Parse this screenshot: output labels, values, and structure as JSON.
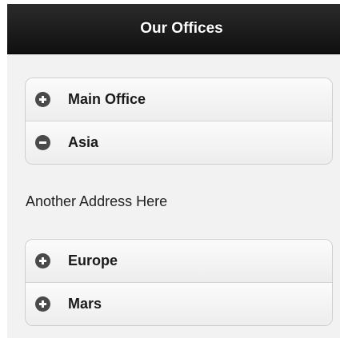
{
  "header": {
    "title": "Our Offices"
  },
  "offices": {
    "main_office": {
      "label": "Main Office",
      "icon": "plus-circle-icon"
    },
    "asia": {
      "label": "Asia",
      "icon": "minus-circle-icon",
      "content": "Another Address Here"
    },
    "europe": {
      "label": "Europe",
      "icon": "plus-circle-icon"
    },
    "mars": {
      "label": "Mars",
      "icon": "plus-circle-icon"
    }
  }
}
